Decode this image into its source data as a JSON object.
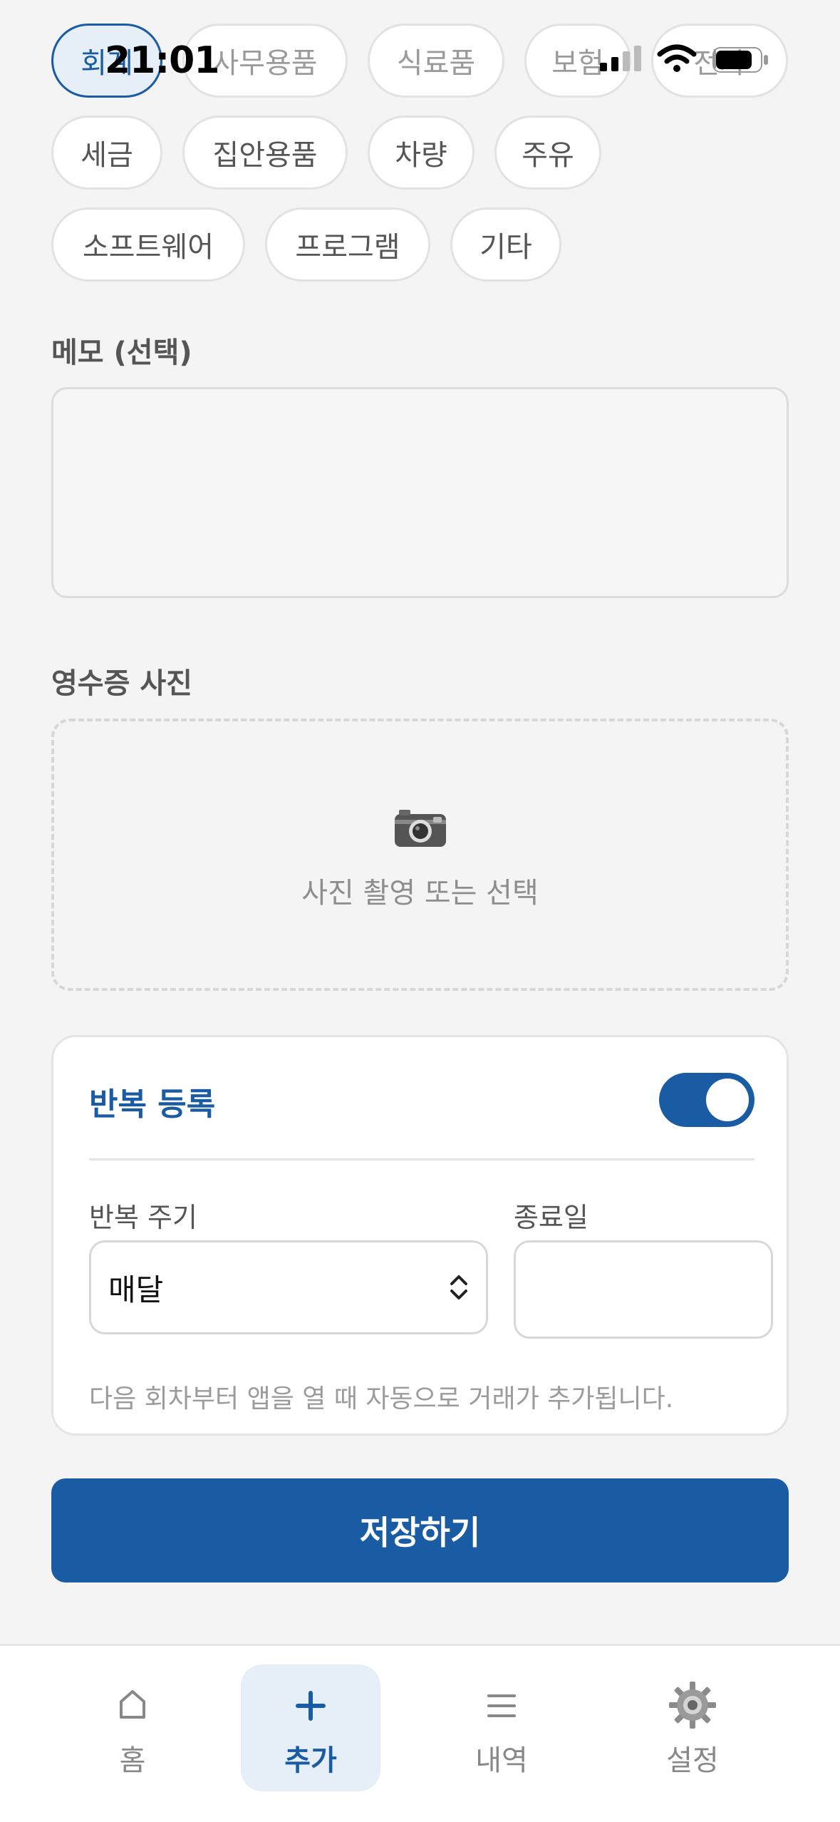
{
  "status_bar": {
    "time": "21:01"
  },
  "categories": {
    "row1": [
      "회계",
      "사무용품",
      "식료품",
      "보험",
      "전자"
    ],
    "row2": [
      "세금",
      "집안용품",
      "차량",
      "주유"
    ],
    "row3": [
      "소프트웨어",
      "프로그램",
      "기타"
    ],
    "selected": "회계"
  },
  "memo": {
    "label": "메모 (선택)",
    "value": ""
  },
  "receipt": {
    "label": "영수증 사진",
    "button_text": "사진 촬영 또는 선택",
    "icon": "camera-icon"
  },
  "repeat": {
    "title": "반복 등록",
    "enabled": true,
    "period_label": "반복 주기",
    "period_value": "매달",
    "end_date_label": "종료일",
    "end_date_value": "",
    "hint": "다음 회차부터 앱을 열 때 자동으로 거래가 추가됩니다."
  },
  "save_button": "저장하기",
  "tabs": [
    {
      "label": "홈",
      "icon": "home-icon"
    },
    {
      "label": "추가",
      "icon": "plus-icon",
      "active": true
    },
    {
      "label": "내역",
      "icon": "list-icon"
    },
    {
      "label": "설정",
      "icon": "gear-icon"
    }
  ],
  "colors": {
    "accent": "#1a5ca3",
    "accent_light": "#e6eef8",
    "background": "#f4f4f5"
  }
}
